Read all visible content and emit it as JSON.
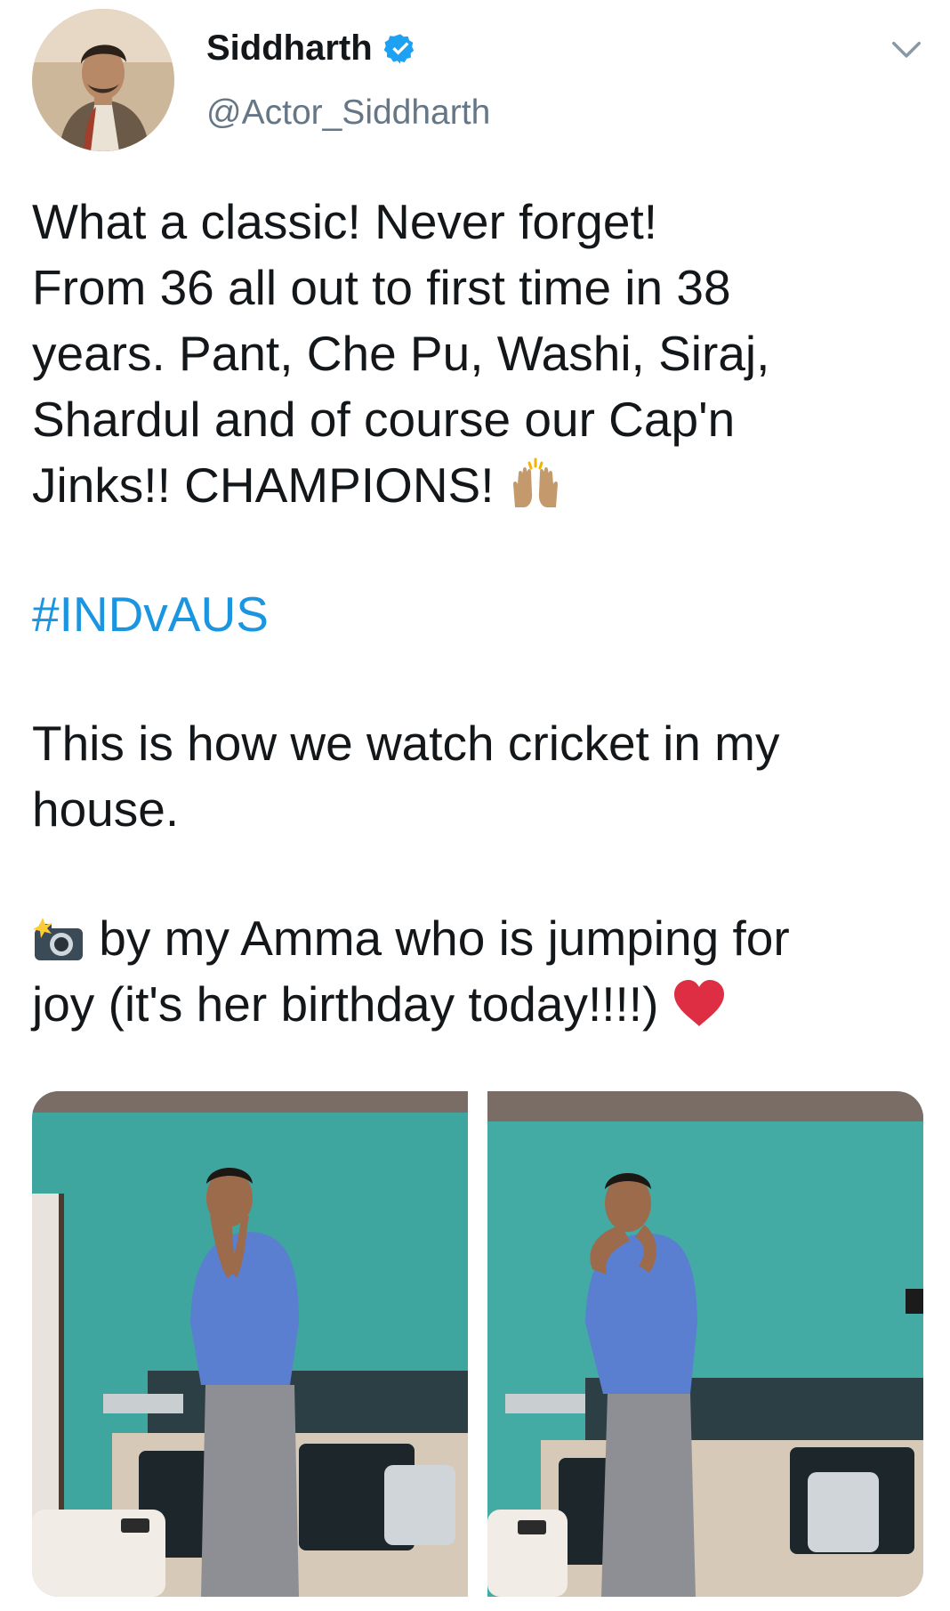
{
  "author": {
    "display_name": "Siddharth",
    "handle": "@Actor_Siddharth",
    "verified": true,
    "avatar_icon": "profile-photo"
  },
  "menu": {
    "icon": "chevron-down-icon"
  },
  "tweet": {
    "line1": "What a classic! Never forget!",
    "line2": "From 36 all out to first time in 38",
    "line3": "years. Pant, Che Pu, Washi, Siraj,",
    "line4": "Shardul and of course our Cap'n",
    "line5": "Jinks!! CHAMPIONS!",
    "hashtag": "#INDvAUS",
    "line6": "This is how we watch cricket in my",
    "line7": "house.",
    "line8": "by my Amma who is jumping for",
    "line9": "joy (it's her birthday today!!!!)",
    "emojis": [
      "raising-hands-icon",
      "camera-flash-icon",
      "red-heart-icon"
    ]
  },
  "media": {
    "count": 2,
    "photos": [
      "photo-1",
      "photo-2"
    ]
  },
  "colors": {
    "link": "#1b95e0",
    "handle": "#657786",
    "verified": "#1da1f2",
    "text": "#14171a"
  }
}
